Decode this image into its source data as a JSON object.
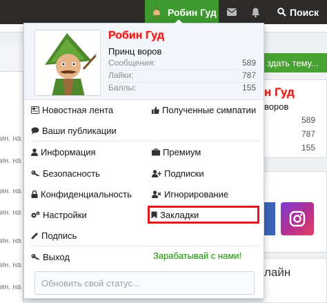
{
  "topbar": {
    "user_name": "Робин Гуд",
    "search_label": "Поиск",
    "icons": [
      "avatar",
      "envelope-icon",
      "bell-icon",
      "search-icon"
    ]
  },
  "background": {
    "create_thread_label": "здать тему...",
    "row_text": "ин. на",
    "card": {
      "name": "н Гуд",
      "title": "воров",
      "stats": [
        "589",
        "787",
        "155"
      ]
    },
    "online_title": "лайн"
  },
  "popup": {
    "name": "Робин Гуд",
    "name_color": "#e0201b",
    "title": "Принц воров",
    "stats": [
      {
        "label": "Сообщения:",
        "value": "589"
      },
      {
        "label": "Лайки:",
        "value": "787"
      },
      {
        "label": "Баллы:",
        "value": "155"
      }
    ],
    "menu_left": [
      {
        "label": "Новостная лента",
        "icon": "newspaper-icon"
      },
      {
        "label": "Ваши публикации",
        "icon": "comment-icon"
      },
      {
        "label": "Информация",
        "icon": "user-icon"
      },
      {
        "label": "Безопасность",
        "icon": "key-icon"
      },
      {
        "label": "Конфиденциальность",
        "icon": "lock-icon"
      },
      {
        "label": "Настройки",
        "icon": "gears-icon"
      },
      {
        "label": "Подпись",
        "icon": "pencil-icon"
      },
      {
        "label": "Выход",
        "icon": "key-icon"
      }
    ],
    "menu_right": [
      {
        "label": "Полученные симпатии",
        "icon": "thumbs-up-icon"
      },
      {
        "label": "Премиум",
        "icon": "briefcase-icon"
      },
      {
        "label": "Подписки",
        "icon": "user-plus-icon"
      },
      {
        "label": "Игнорирование",
        "icon": "user-times-icon"
      },
      {
        "label": "Закладки",
        "icon": "bookmark-icon"
      }
    ],
    "highlight_color": "#e3171b",
    "earn_label": "Зарабатывай с нами!",
    "status_placeholder": "Обновить свой статус..."
  }
}
